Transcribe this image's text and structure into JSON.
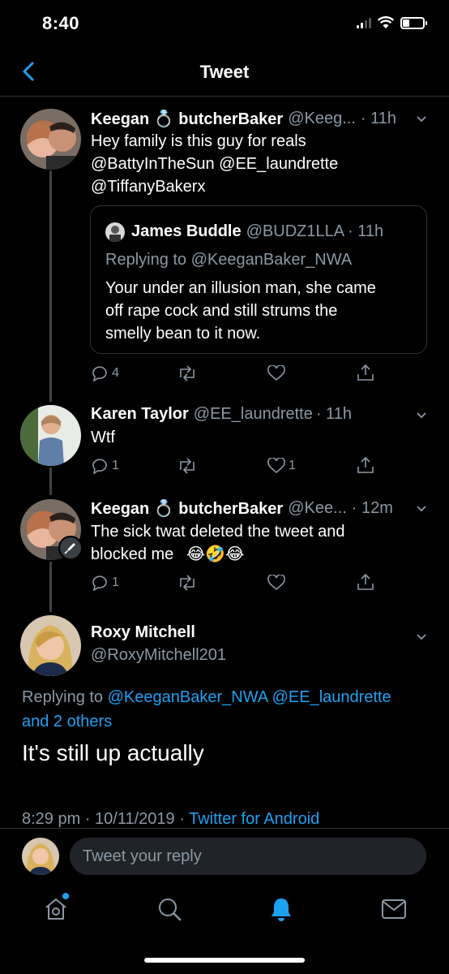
{
  "status": {
    "time": "8:40"
  },
  "header": {
    "title": "Tweet"
  },
  "tweets": [
    {
      "name": "Keegan 💍 butcherBaker",
      "handle": "@Keeg...",
      "time": "· 11h",
      "text_line1": "Hey family is this guy for reals",
      "mentions_line1": "@BattyInTheSun @EE_laundrette",
      "mentions_line2": "@TiffanyBakerx",
      "replies": "4",
      "likes": ""
    },
    {
      "name": "Karen Taylor",
      "handle": "@EE_laundrette",
      "time": "· 11h",
      "text": "Wtf",
      "replies": "1",
      "likes": "1"
    },
    {
      "name": "Keegan 💍 butcherBaker",
      "handle": "@Kee...",
      "time": "· 12m",
      "text_line1": "The sick twat deleted the tweet and",
      "text_line2": "blocked me",
      "emoji": "😂🤣😂",
      "replies": "1"
    }
  ],
  "quote": {
    "name": "James Buddle",
    "handle": "@BUDZ1LLA",
    "time": "· 11h",
    "replying_prefix": "Replying to",
    "replying_to": "@KeeganBaker_NWA",
    "text_line1": "Your under an illusion man, she came",
    "text_line2": "off rape cock and still strums the",
    "text_line3": "smelly bean to it now."
  },
  "main_tweet": {
    "name": "Roxy Mitchell",
    "handle": "@RoxyMitchell201",
    "replying_prefix": "Replying to",
    "replying_mentions": "@KeeganBaker_NWA @EE_laundrette",
    "replying_others": "and 2 others",
    "text": "It's still up actually",
    "time": "8:29 pm · 10/11/2019 ·",
    "source": "Twitter for Android"
  },
  "reply": {
    "placeholder": "Tweet your reply"
  },
  "icons": [
    "back-icon",
    "reply-icon",
    "retweet-icon",
    "like-icon",
    "share-icon",
    "caret-icon",
    "home-icon",
    "search-icon",
    "notifications-icon",
    "messages-icon"
  ],
  "colors": {
    "background": "#000000",
    "accent": "#1da1f2",
    "muted": "#8b98a5",
    "divider": "#2f3336"
  }
}
